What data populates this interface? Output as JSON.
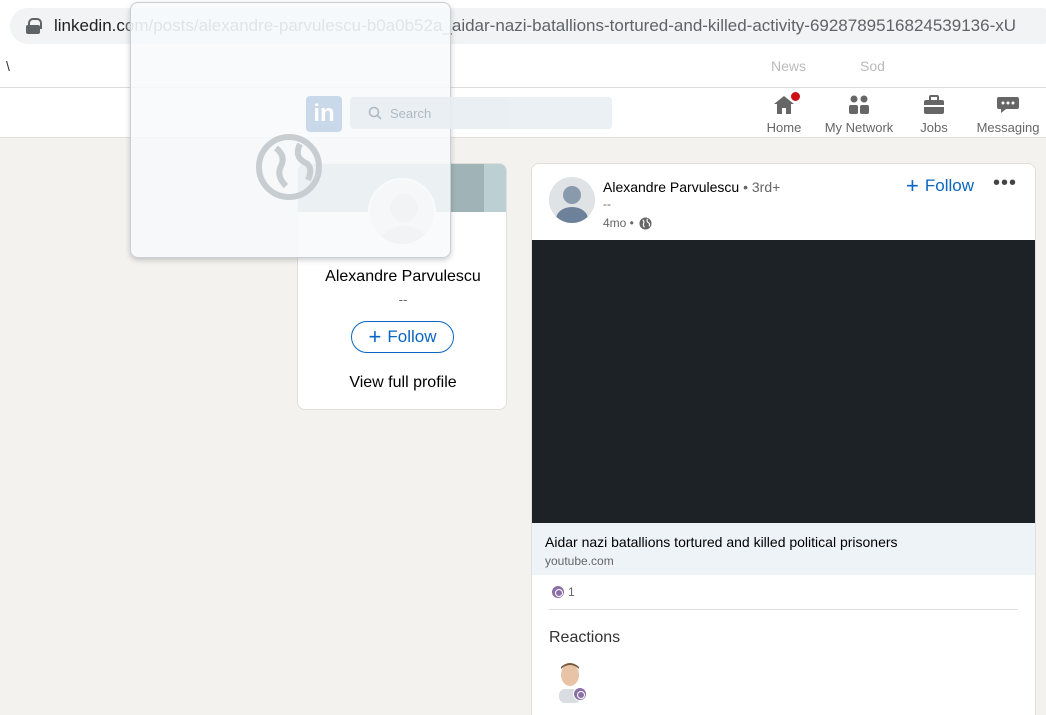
{
  "browser": {
    "url_host": "linkedin.c",
    "url_path": "om/posts/alexandre-parvulescu-b0a0b52a_aidar-nazi-batallions-tortured-and-killed-activity-6928789516824539136-xU"
  },
  "bookmarks": [
    {
      "label": "\\"
    },
    {
      "label": "News"
    },
    {
      "label": "Sod"
    }
  ],
  "nav": {
    "items": [
      {
        "label": "Home",
        "icon": "home-icon"
      },
      {
        "label": "My Network",
        "icon": "network-icon"
      },
      {
        "label": "Jobs",
        "icon": "briefcase-icon"
      },
      {
        "label": "Messaging",
        "icon": "chat-icon"
      }
    ],
    "search_placeholder": "Search",
    "logo_text": "in"
  },
  "profile_card": {
    "name": "Alexandre Parvulescu",
    "headline": "--",
    "follow_label": "Follow",
    "view_profile_label": "View full profile"
  },
  "post": {
    "author": "Alexandre Parvulescu",
    "degree": "• 3rd+",
    "headline": "--",
    "time": "4mo •",
    "follow_label": "Follow",
    "more_label": "•••",
    "link_title": "Aidar nazi batallions tortured and killed political prisoners",
    "link_domain": "youtube.com",
    "reaction_count": "1",
    "reactions_heading": "Reactions"
  },
  "colors": {
    "linkedin_blue": "#0a66c2",
    "video_bg": "#1d2226",
    "page_bg": "#f3f2ef",
    "notification_red": "#cc1016"
  }
}
